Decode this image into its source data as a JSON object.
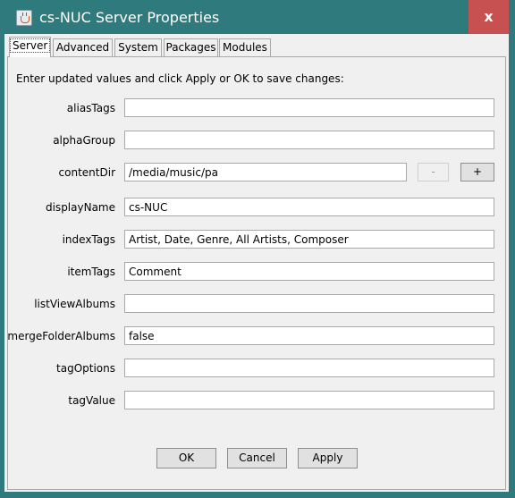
{
  "window": {
    "title": "cs-NUC Server Properties",
    "close_label": "x"
  },
  "tabs": [
    {
      "label": "Server",
      "active": true
    },
    {
      "label": "Advanced",
      "active": false
    },
    {
      "label": "System",
      "active": false
    },
    {
      "label": "Packages",
      "active": false
    },
    {
      "label": "Modules",
      "active": false
    }
  ],
  "instructions": "Enter updated values and click Apply or OK to save changes:",
  "fields": [
    {
      "label": "aliasTags",
      "value": ""
    },
    {
      "label": "alphaGroup",
      "value": ""
    },
    {
      "label": "contentDir",
      "value": "/media/music/pa"
    },
    {
      "label": "displayName",
      "value": "cs-NUC"
    },
    {
      "label": "indexTags",
      "value": "Artist, Date, Genre, All Artists, Composer"
    },
    {
      "label": "itemTags",
      "value": "Comment"
    },
    {
      "label": "listViewAlbums",
      "value": ""
    },
    {
      "label": "mergeFolderAlbums",
      "value": "false"
    },
    {
      "label": "tagOptions",
      "value": ""
    },
    {
      "label": "tagValue",
      "value": ""
    }
  ],
  "content_dir_buttons": {
    "remove_label": "-",
    "add_label": "+"
  },
  "buttons": {
    "ok": "OK",
    "cancel": "Cancel",
    "apply": "Apply"
  },
  "icons": {
    "app": "java-cup-icon"
  },
  "colors": {
    "titlebar": "#2f7a7c",
    "close_button": "#c75050"
  }
}
